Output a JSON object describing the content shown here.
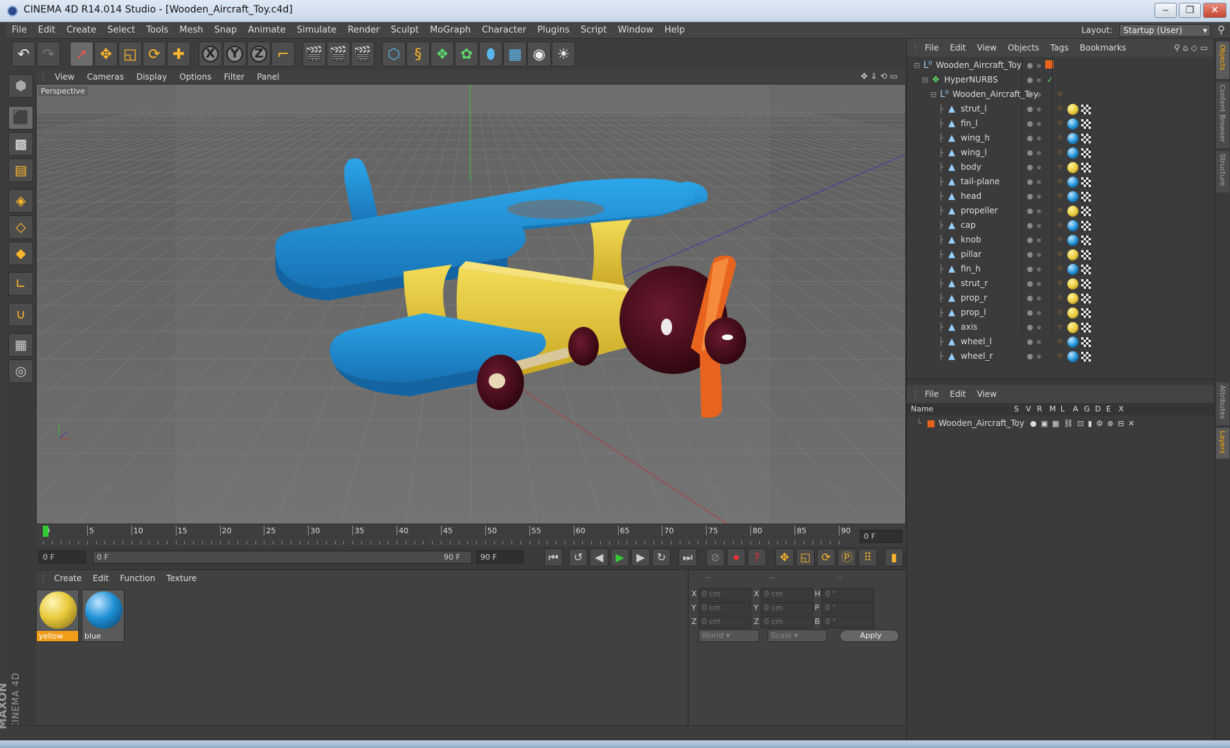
{
  "window": {
    "title": "CINEMA 4D R14.014 Studio - [Wooden_Aircraft_Toy.c4d]",
    "min": "‒",
    "max": "❐",
    "close": "✕"
  },
  "menu": [
    "File",
    "Edit",
    "Create",
    "Select",
    "Tools",
    "Mesh",
    "Snap",
    "Animate",
    "Simulate",
    "Render",
    "Sculpt",
    "MoGraph",
    "Character",
    "Plugins",
    "Script",
    "Window",
    "Help"
  ],
  "layout": {
    "label": "Layout:",
    "value": "Startup (User)"
  },
  "viewport": {
    "menu": [
      "View",
      "Cameras",
      "Display",
      "Options",
      "Filter",
      "Panel"
    ],
    "label": "Perspective"
  },
  "timeline": {
    "ticks": [
      "0",
      "5",
      "10",
      "15",
      "20",
      "25",
      "30",
      "35",
      "40",
      "45",
      "50",
      "55",
      "60",
      "65",
      "70",
      "75",
      "80",
      "85",
      "90"
    ],
    "frame": "0 F"
  },
  "transport": {
    "start": "0 F",
    "range_start": "0 F",
    "range_end": "90 F",
    "end": "90 F"
  },
  "materials": {
    "menu": [
      "Create",
      "Edit",
      "Function",
      "Texture"
    ],
    "items": [
      {
        "name": "yellow"
      },
      {
        "name": "blue"
      }
    ]
  },
  "coords": {
    "headers": [
      "--",
      "--",
      "--"
    ],
    "rows": [
      [
        "X",
        "0 cm",
        "X",
        "0 cm",
        "H",
        "0 °"
      ],
      [
        "Y",
        "0 cm",
        "Y",
        "0 cm",
        "P",
        "0 °"
      ],
      [
        "Z",
        "0 cm",
        "Z",
        "0 cm",
        "B",
        "0 °"
      ]
    ],
    "mode1": "World",
    "mode2": "Scale",
    "apply": "Apply"
  },
  "objects": {
    "menu": [
      "File",
      "Edit",
      "View",
      "Objects",
      "Tags",
      "Bookmarks"
    ],
    "root": "Wooden_Aircraft_Toy",
    "nurbs": "HyperNURBS",
    "group": "Wooden_Aircraft_Toy",
    "items": [
      {
        "name": "strut_l",
        "mat": "yellow"
      },
      {
        "name": "fin_l",
        "mat": "blue"
      },
      {
        "name": "wing_h",
        "mat": "blue"
      },
      {
        "name": "wing_l",
        "mat": "blue"
      },
      {
        "name": "body",
        "mat": "yellow"
      },
      {
        "name": "tail-plane",
        "mat": "blue"
      },
      {
        "name": "head",
        "mat": "blue"
      },
      {
        "name": "propeller",
        "mat": "yellow"
      },
      {
        "name": "cap",
        "mat": "blue"
      },
      {
        "name": "knob",
        "mat": "blue"
      },
      {
        "name": "pillar",
        "mat": "yellow"
      },
      {
        "name": "fin_h",
        "mat": "blue"
      },
      {
        "name": "strut_r",
        "mat": "yellow"
      },
      {
        "name": "prop_r",
        "mat": "yellow"
      },
      {
        "name": "prop_l",
        "mat": "yellow"
      },
      {
        "name": "axis",
        "mat": "yellow"
      },
      {
        "name": "wheel_l",
        "mat": "blue"
      },
      {
        "name": "wheel_r",
        "mat": "blue"
      }
    ]
  },
  "layers": {
    "menu": [
      "File",
      "Edit",
      "View"
    ],
    "cols": [
      "Name",
      "S",
      "V",
      "R",
      "M",
      "L",
      "A",
      "G",
      "D",
      "E",
      "X"
    ],
    "row": "Wooden_Aircraft_Toy"
  },
  "righttabs": [
    "Objects",
    "Content Browser",
    "Structure",
    "Attributes",
    "Layers"
  ],
  "brand": {
    "a": "MAXON",
    "b": "CINEMA 4D"
  },
  "colors": {
    "accent": "#ffb72c",
    "yellowMat": "#e8c93a",
    "blueMat": "#1e8fd4",
    "orange": "#e8641e",
    "maroon": "#4a0d1e"
  }
}
